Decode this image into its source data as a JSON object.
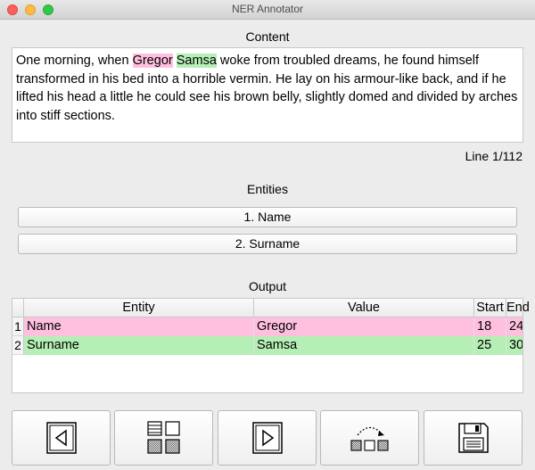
{
  "window": {
    "title": "NER Annotator"
  },
  "content": {
    "label": "Content",
    "text_before": "One morning, when ",
    "entity1": "Gregor",
    "space": " ",
    "entity2": "Samsa",
    "text_after": " woke from troubled dreams, he found himself transformed in his bed into a horrible vermin. He lay on his armour-like back, and if he lifted his head a little he could see his brown belly, slightly domed and divided by arches into stiff sections."
  },
  "status": {
    "line": "Line 1/112"
  },
  "entities": {
    "label": "Entities",
    "items": [
      {
        "label": "1. Name"
      },
      {
        "label": "2. Surname"
      }
    ]
  },
  "output": {
    "label": "Output",
    "columns": [
      "Entity",
      "Value",
      "Start",
      "End"
    ],
    "rows": [
      {
        "num": "1",
        "entity": "Name",
        "value": "Gregor",
        "start": "18",
        "end": "24"
      },
      {
        "num": "2",
        "entity": "Surname",
        "value": "Samsa",
        "start": "25",
        "end": "30"
      }
    ]
  },
  "toolbar": {
    "buttons": [
      {
        "icon": "previous-icon"
      },
      {
        "icon": "grid-view-icon"
      },
      {
        "icon": "next-icon"
      },
      {
        "icon": "shift-icon"
      },
      {
        "icon": "save-icon"
      }
    ]
  },
  "colors": {
    "name_highlight": "#ffc0df",
    "surname_highlight": "#b6efb6"
  }
}
